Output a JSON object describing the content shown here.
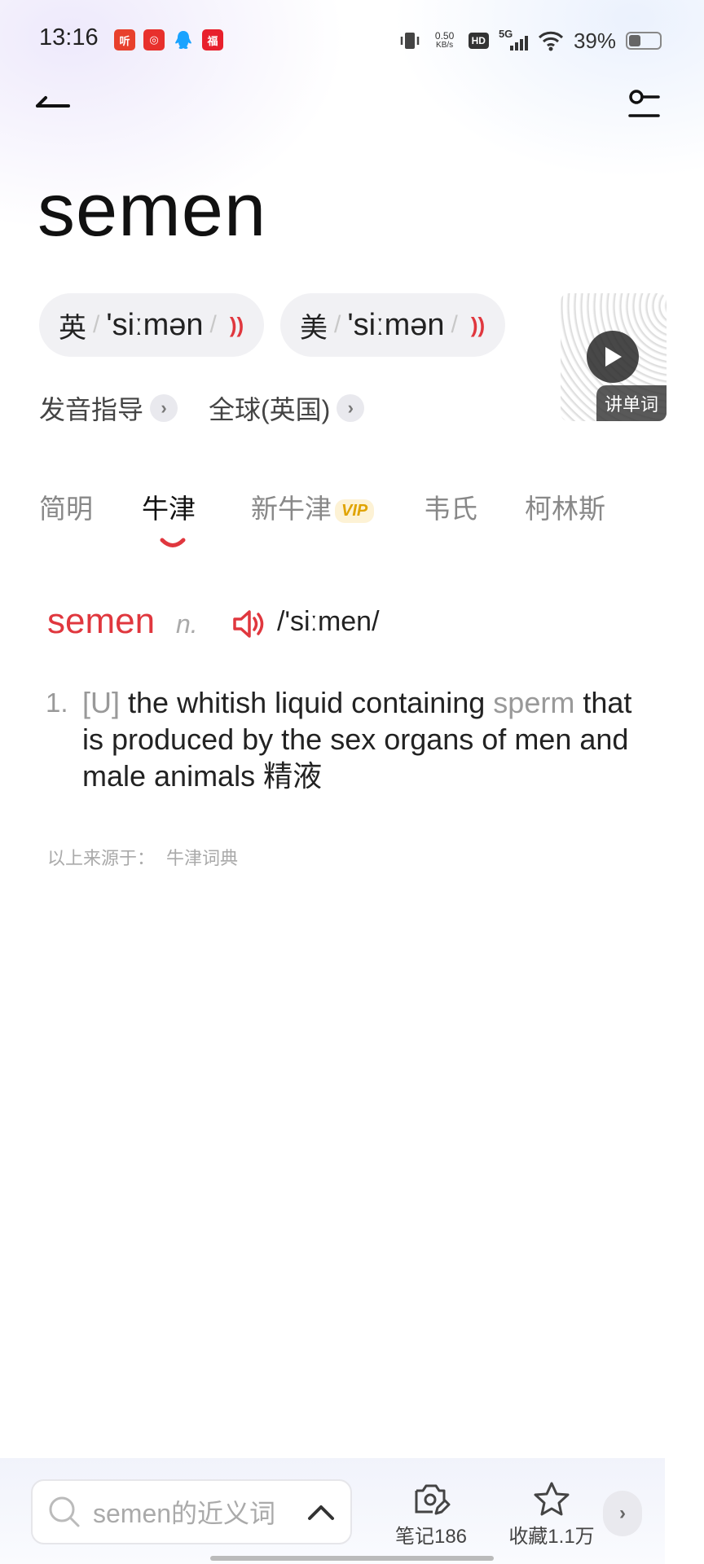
{
  "status_bar": {
    "time": "13:16",
    "app_icons": [
      {
        "label": "听",
        "color": "#e8402c"
      },
      {
        "label": "◎",
        "color": "#e8302c"
      },
      {
        "label": "",
        "color": "#1aa3ff"
      },
      {
        "label": "福",
        "color": "#e8202c"
      }
    ],
    "net_speed_value": "0.50",
    "net_speed_unit": "KB/s",
    "hd": "HD",
    "network": "5G",
    "battery_percent": "39%",
    "battery_level": 0.39
  },
  "header": {
    "headword": "semen"
  },
  "pronunciation": {
    "uk": {
      "label": "英",
      "ipa": "'siːmən"
    },
    "us": {
      "label": "美",
      "ipa": "'siːmən"
    },
    "guide": "发音指导",
    "global": "全球(英国)",
    "video_label": "讲单词"
  },
  "tabs": [
    {
      "label": "简明",
      "active": false
    },
    {
      "label": "牛津",
      "active": true
    },
    {
      "label": "新牛津",
      "active": false,
      "badge": "VIP"
    },
    {
      "label": "韦氏",
      "active": false
    },
    {
      "label": "柯林斯",
      "active": false
    }
  ],
  "entry": {
    "word": "semen",
    "pos": "n.",
    "ipa": "/'siːmen/",
    "definitions": [
      {
        "number": "1.",
        "grammar": "[U]",
        "text_before": " the whitish liquid containing ",
        "xref": "sperm",
        "text_after": " that is produced by the sex organs of men and male animals ",
        "translation": "精液"
      }
    ],
    "source_prefix": "以上来源于：",
    "source_name": "牛津词典"
  },
  "bottom_bar": {
    "search_placeholder": "semen的近义词",
    "notes_label": "笔记186",
    "favorites_label": "收藏1.1万"
  },
  "colors": {
    "accent_red": "#e0373e",
    "vip_gold": "#e0a300"
  }
}
